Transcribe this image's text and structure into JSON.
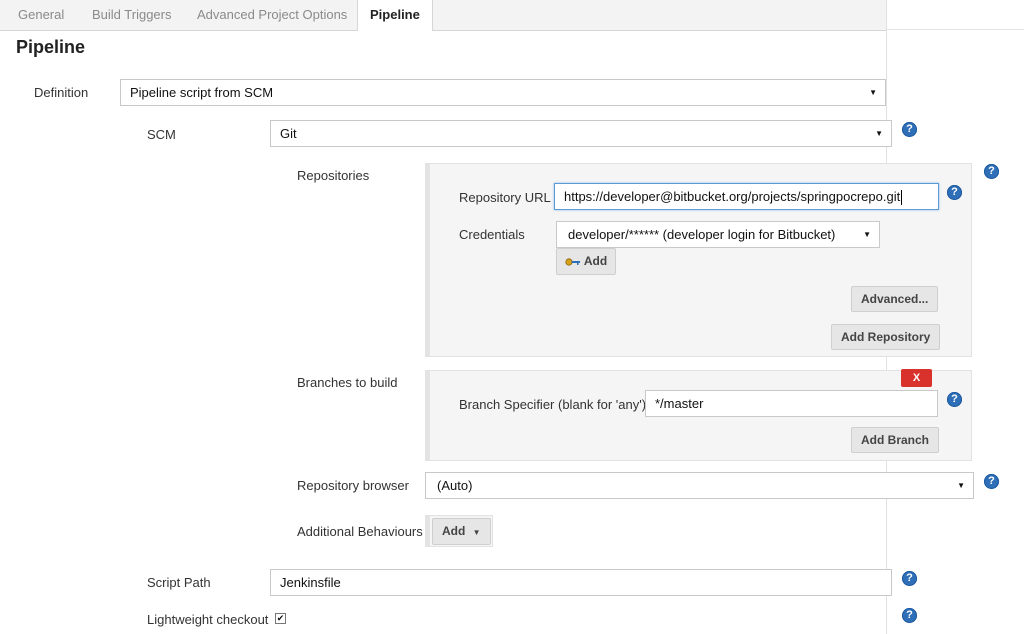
{
  "tabs": [
    {
      "label": "General"
    },
    {
      "label": "Build Triggers"
    },
    {
      "label": "Advanced Project Options"
    },
    {
      "label": "Pipeline"
    }
  ],
  "section_title": "Pipeline",
  "definition": {
    "label": "Definition",
    "value": "Pipeline script from SCM"
  },
  "scm": {
    "label": "SCM",
    "value": "Git"
  },
  "repositories": {
    "label": "Repositories",
    "url_label": "Repository URL",
    "url_value": "https://developer@bitbucket.org/projects/springpocrepo.git",
    "credentials_label": "Credentials",
    "credentials_value": "developer/****** (developer login for Bitbucket)",
    "add_label": "Add",
    "advanced_label": "Advanced...",
    "add_repository_label": "Add Repository"
  },
  "branches": {
    "label": "Branches to build",
    "delete_label": "X",
    "specifier_label": "Branch Specifier (blank for 'any')",
    "specifier_value": "*/master",
    "add_branch_label": "Add Branch"
  },
  "repo_browser": {
    "label": "Repository browser",
    "value": "(Auto)"
  },
  "additional_behaviours": {
    "label": "Additional Behaviours",
    "add_label": "Add"
  },
  "script_path": {
    "label": "Script Path",
    "value": "Jenkinsfile"
  },
  "lightweight": {
    "label": "Lightweight checkout",
    "checked": true
  },
  "help_glyph": "?",
  "dropdown_glyph": "▼",
  "check_glyph": "✔",
  "colors": {
    "help": "#2f6fb7",
    "delete": "#d9312b",
    "focus": "#5b9bd5"
  }
}
